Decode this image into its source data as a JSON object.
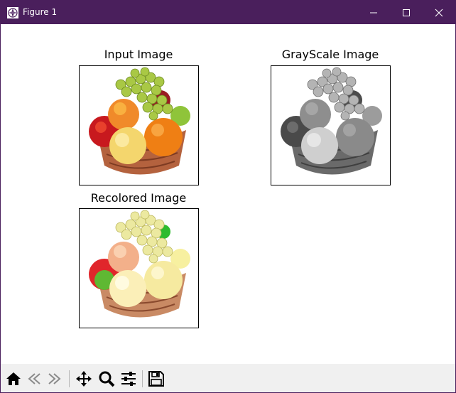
{
  "window": {
    "title": "Figure 1",
    "accent_color": "#4a1f5c",
    "controls": [
      "minimize-icon",
      "maximize-icon",
      "close-icon"
    ]
  },
  "figure": {
    "panels": [
      {
        "title": "Input Image",
        "image": "colored fruit basket (grapes, apples, orange, peach in woven basket)"
      },
      {
        "title": "GrayScale Image",
        "image": "grayscale fruit basket"
      },
      {
        "title": "Recolored Image",
        "image": "recolored fruit basket with pale yellow tones"
      }
    ]
  },
  "toolbar": {
    "buttons": [
      "home-icon",
      "back-icon",
      "forward-icon",
      "pan-icon",
      "zoom-icon",
      "configure-subplots-icon",
      "save-icon"
    ]
  }
}
